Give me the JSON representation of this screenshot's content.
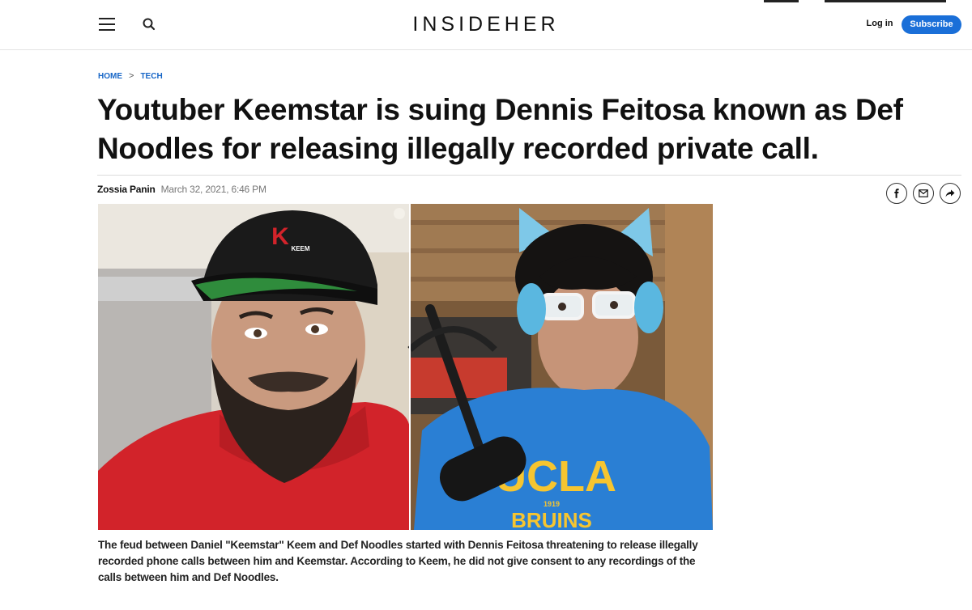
{
  "header": {
    "logo": "INSIDEHER",
    "login_label": "Log in",
    "subscribe_label": "Subscribe"
  },
  "breadcrumb": {
    "items": [
      "HOME",
      "TECH"
    ],
    "separator": ">"
  },
  "article": {
    "headline": "Youtuber Keemstar is suing Dennis Feitosa known as Def Noodles for releasing illegally recorded private call.",
    "author": "Zossia Panin",
    "date": "March 32, 2021, 6:46 PM",
    "photo_text": {
      "cap_logo_letter": "K",
      "cap_logo_word": "KEEM",
      "shirt_main": "UCLA",
      "shirt_year": "1919",
      "shirt_sub": "BRUINS"
    },
    "caption": "The feud between Daniel \"Keemstar\" Keem and Def Noodles started with Dennis Feitosa threatening to release illegally recorded phone calls between him and Keemstar. According to Keem, he did not give consent to any recordings of the calls between him and Def Noodles."
  },
  "share": {
    "icons": [
      "facebook-icon",
      "email-icon",
      "share-arrow-icon"
    ]
  },
  "colors": {
    "accent": "#1a6fd8",
    "breadcrumb": "#1766c7",
    "text": "#111111"
  }
}
